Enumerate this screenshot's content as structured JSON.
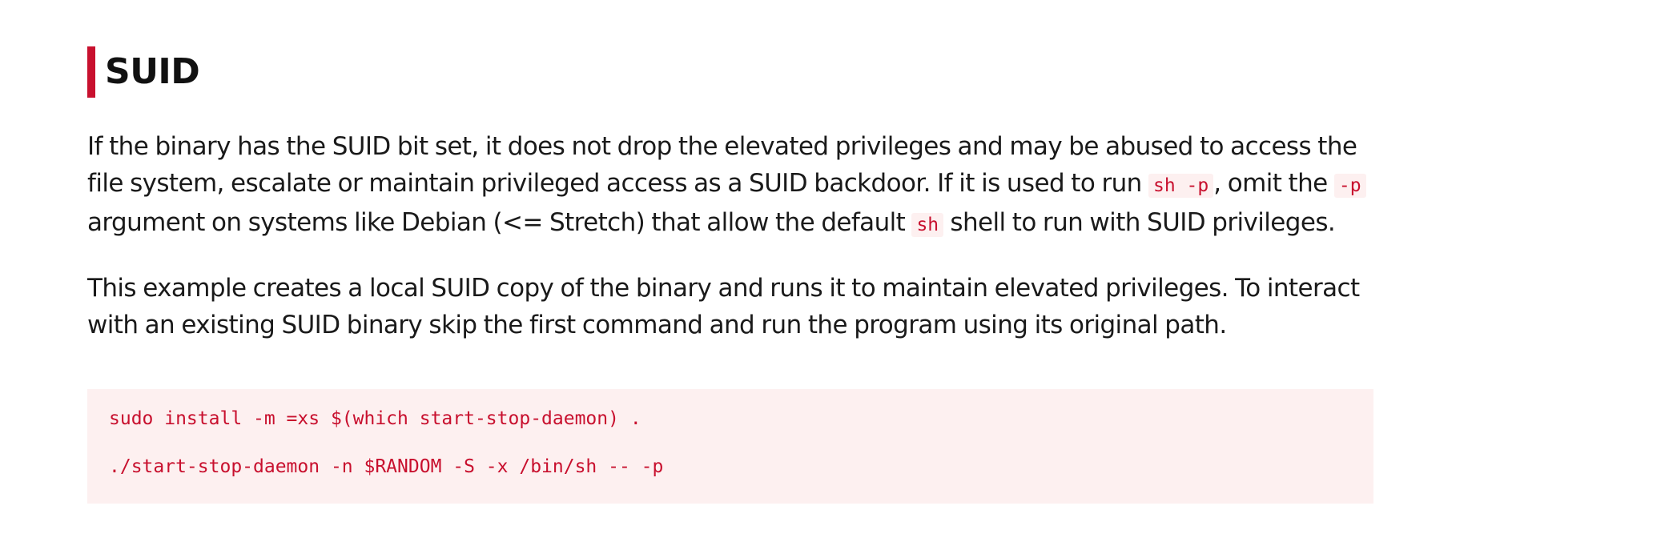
{
  "section": {
    "title": "SUID"
  },
  "paragraph1": {
    "text1": "If the binary has the SUID bit set, it does not drop the elevated privileges and may be abused to access the file system, escalate or maintain privileged access as a SUID backdoor. If it is used to run ",
    "code1": "sh -p",
    "text2": ", omit the ",
    "code2": "-p",
    "text3": " argument on systems like Debian (<= Stretch) that allow the default ",
    "code3": "sh",
    "text4": " shell to run with SUID privileges."
  },
  "paragraph2": {
    "text": "This example creates a local SUID copy of the binary and runs it to maintain elevated privileges. To interact with an existing SUID binary skip the first command and run the program using its original path."
  },
  "code_block": {
    "lines": [
      "sudo install -m =xs $(which start-stop-daemon) .",
      "./start-stop-daemon -n $RANDOM -S -x /bin/sh -- -p"
    ]
  },
  "colors": {
    "accent": "#c8102e",
    "code_background": "#fdf0f0",
    "text": "#1a1a1a"
  }
}
